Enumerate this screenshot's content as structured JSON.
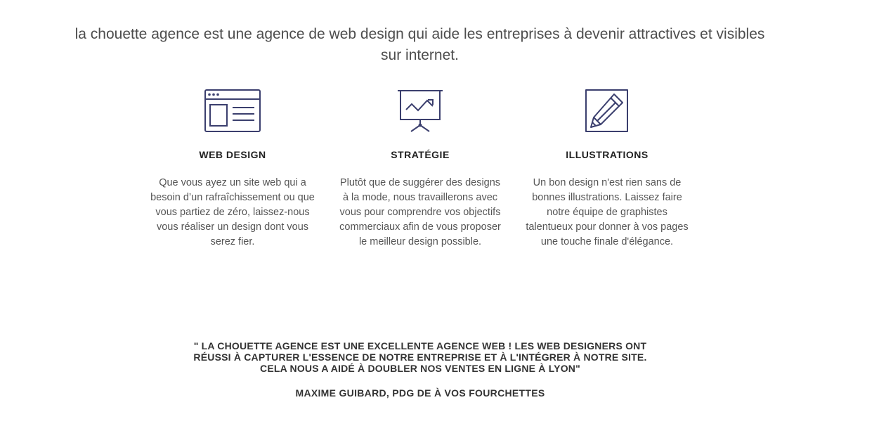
{
  "intro": {
    "text": "la chouette agence est une agence de web design qui aide les entreprises à devenir attractives et visibles sur internet."
  },
  "services": [
    {
      "icon": "browser-window-icon",
      "title": "WEB DESIGN",
      "description": "Que vous ayez un site web qui a besoin d’un rafraîchissement ou que vous partiez de zéro, laissez-nous vous réaliser un design dont vous serez fier."
    },
    {
      "icon": "presentation-chart-icon",
      "title": "STRATÉGIE",
      "description": "Plutôt que de suggérer des designs à la mode, nous travaillerons avec vous pour comprendre vos objectifs commerciaux afin de vous proposer le meilleur design possible."
    },
    {
      "icon": "pencil-edit-icon",
      "title": "ILLUSTRATIONS",
      "description": "Un bon design n'est rien sans de bonnes illustrations. Laissez faire notre équipe de graphistes talentueux pour donner à vos pages une touche finale d'élégance."
    }
  ],
  "testimonial": {
    "quote": "\" LA CHOUETTE AGENCE EST UNE EXCELLENTE AGENCE WEB ! LES WEB DESIGNERS ONT RÉUSSI À CAPTURER L'ESSENCE DE NOTRE ENTREPRISE ET À L'INTÉGRER À NOTRE SITE. CELA NOUS A AIDÉ À DOUBLER NOS VENTES EN LIGNE À LYON\"",
    "author": "MAXIME GUIBARD, PDG DE À VOS FOURCHETTES"
  },
  "colors": {
    "icon": "#3b3f6e",
    "text": "#555555",
    "heading": "#222222"
  }
}
